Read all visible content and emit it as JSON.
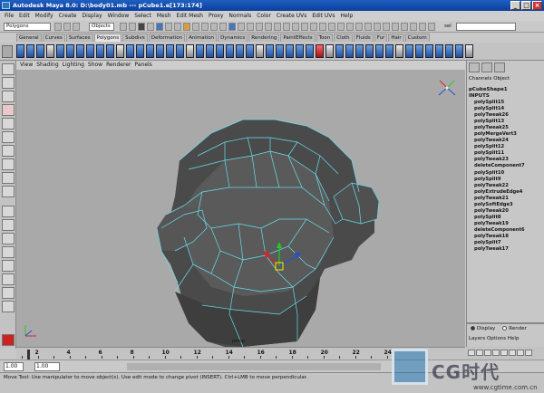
{
  "window": {
    "title": "Autodesk Maya 8.0: D:\\body01.mb    ---    pCube1.e[173:174]"
  },
  "menubar": [
    "File",
    "Edit",
    "Modify",
    "Create",
    "Display",
    "Window",
    "Select",
    "Mesh",
    "Edit Mesh",
    "Proxy",
    "Normals",
    "Color",
    "Create UVs",
    "Edit UVs",
    "Help"
  ],
  "statusline": {
    "menu_set": "Polygons",
    "selection_mode": "Objects",
    "sel_label": "sel"
  },
  "shelf_tabs": [
    {
      "label": "General",
      "active": false
    },
    {
      "label": "Curves",
      "active": false
    },
    {
      "label": "Surfaces",
      "active": false
    },
    {
      "label": "Polygons",
      "active": true
    },
    {
      "label": "Subdivs",
      "active": false
    },
    {
      "label": "Deformation",
      "active": false
    },
    {
      "label": "Animation",
      "active": false
    },
    {
      "label": "Dynamics",
      "active": false
    },
    {
      "label": "Rendering",
      "active": false
    },
    {
      "label": "PaintEffects",
      "active": false
    },
    {
      "label": "Toon",
      "active": false
    },
    {
      "label": "Cloth",
      "active": false
    },
    {
      "label": "Fluids",
      "active": false
    },
    {
      "label": "Fur",
      "active": false
    },
    {
      "label": "Hair",
      "active": false
    },
    {
      "label": "Custom",
      "active": false
    }
  ],
  "panel_menu": [
    "View",
    "Shading",
    "Lighting",
    "Show",
    "Renderer",
    "Panels"
  ],
  "viewport": {
    "background": "#a9a9a9",
    "mesh_color": "#4a4a4a",
    "edge_color": "#66e0ee",
    "camera_label": "persp"
  },
  "channel_box": {
    "menu": "Channels  Object",
    "node": "pCubeShape1",
    "inputs_label": "INPUTS",
    "inputs": [
      "polySplit15",
      "polySplit14",
      "polyTweak26",
      "polySplit13",
      "polyTweak25",
      "polyMergeVert3",
      "polyTweak24",
      "polySplit12",
      "polySplit11",
      "polyTweak23",
      "deleteComponent7",
      "polySplit10",
      "polySplit9",
      "polyTweak22",
      "polyExtrudeEdge4",
      "polyTweak21",
      "polySoftEdge3",
      "polyTweak20",
      "polySplit8",
      "polyTweak19",
      "deleteComponent6",
      "polyTweak18",
      "polySplit7",
      "polyTweak17"
    ]
  },
  "layer_editor": {
    "display_label": "Display",
    "render_label": "Render",
    "menu": "Layers  Options  Help"
  },
  "time_slider": {
    "ticks": [
      2,
      4,
      6,
      8,
      10,
      12,
      14,
      16,
      18,
      20,
      22,
      24
    ]
  },
  "range_slider": {
    "start": "1.00",
    "current": "1.00"
  },
  "help_line": "Move Tool: Use manipulator to move object(s). Use edit mode to change pivot (INSERT). Ctrl+LMB to move perpendicular.",
  "watermark": {
    "text": "CG时代",
    "url": "www.cgtime.com.cn"
  }
}
